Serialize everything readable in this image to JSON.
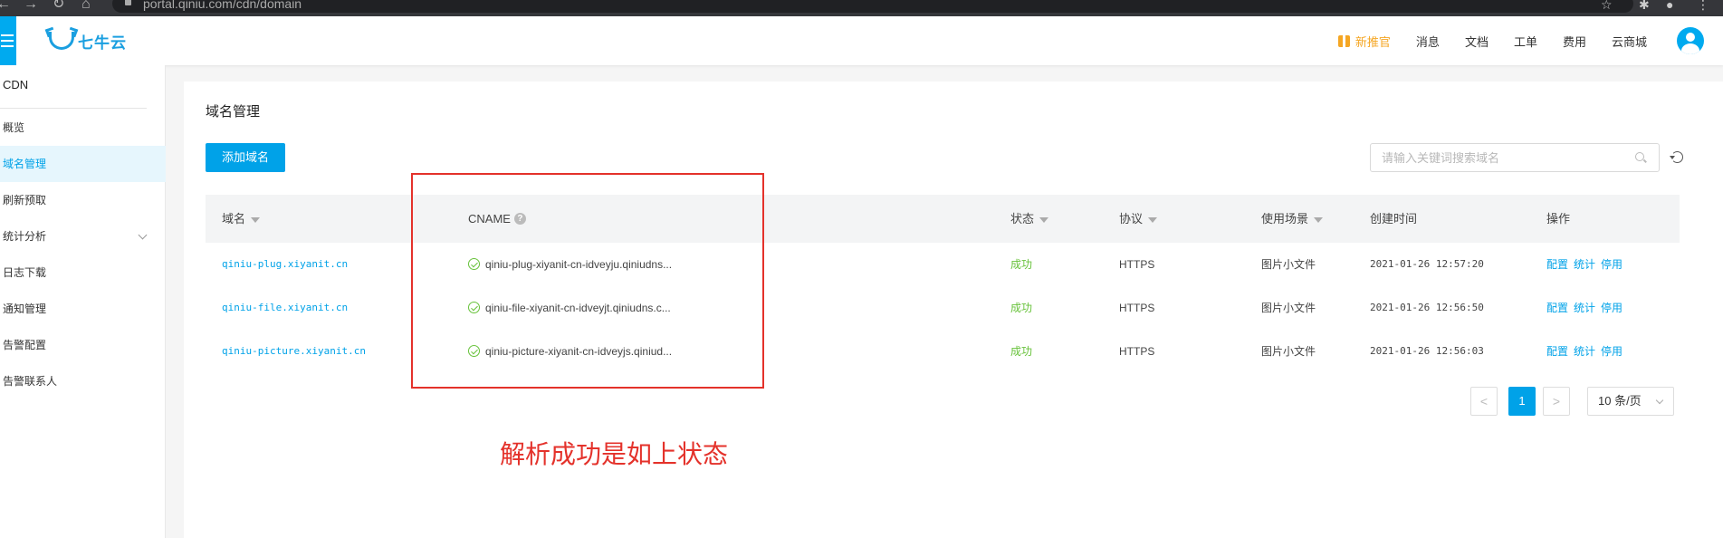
{
  "browser": {
    "url": "portal.qiniu.com/cdn/domain"
  },
  "topnav": {
    "logo_text": "七牛云",
    "promo_label": "新推官",
    "items": [
      "消息",
      "文档",
      "工单",
      "费用",
      "云商城"
    ],
    "accent_color": "#00aaef"
  },
  "sidebar": {
    "title": "CDN",
    "items": [
      {
        "label": "概览",
        "active": false
      },
      {
        "label": "域名管理",
        "active": true
      },
      {
        "label": "刷新预取",
        "active": false
      },
      {
        "label": "统计分析",
        "active": false,
        "expandable": true
      },
      {
        "label": "日志下载",
        "active": false
      },
      {
        "label": "通知管理",
        "active": false
      },
      {
        "label": "告警配置",
        "active": false
      },
      {
        "label": "告警联系人",
        "active": false
      }
    ]
  },
  "main": {
    "page_title": "域名管理",
    "add_button": "添加域名",
    "search_placeholder": "请输入关键词搜索域名",
    "table": {
      "columns": [
        "域名",
        "CNAME",
        "状态",
        "协议",
        "使用场景",
        "创建时间",
        "操作"
      ],
      "rows": [
        {
          "domain": "qiniu-plug.xiyanit.cn",
          "cname": "qiniu-plug-xiyanit-cn-idveyju.qiniudns...",
          "status": "成功",
          "protocol": "HTTPS",
          "scene": "图片小文件",
          "created": "2021-01-26 12:57:20",
          "ops": [
            "配置",
            "统计",
            "停用"
          ]
        },
        {
          "domain": "qiniu-file.xiyanit.cn",
          "cname": "qiniu-file-xiyanit-cn-idveyjt.qiniudns.c...",
          "status": "成功",
          "protocol": "HTTPS",
          "scene": "图片小文件",
          "created": "2021-01-26 12:56:50",
          "ops": [
            "配置",
            "统计",
            "停用"
          ]
        },
        {
          "domain": "qiniu-picture.xiyanit.cn",
          "cname": "qiniu-picture-xiyanit-cn-idveyjs.qiniud...",
          "status": "成功",
          "protocol": "HTTPS",
          "scene": "图片小文件",
          "created": "2021-01-26 12:56:03",
          "ops": [
            "配置",
            "统计",
            "停用"
          ]
        }
      ]
    },
    "pagination": {
      "prev": "<",
      "current_page": "1",
      "next": ">",
      "page_size": "10 条/页"
    }
  },
  "annotation": {
    "text": "解析成功是如上状态",
    "color": "#e4322b"
  }
}
